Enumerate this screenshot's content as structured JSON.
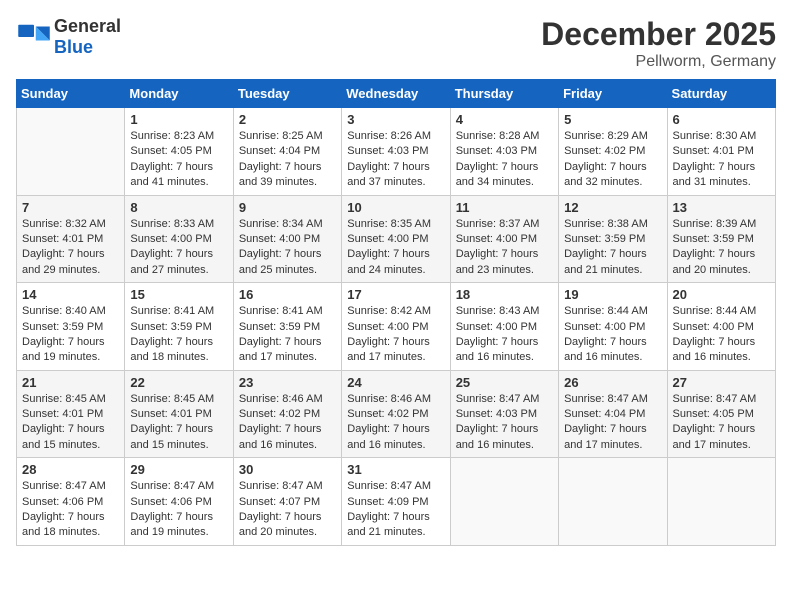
{
  "header": {
    "logo_general": "General",
    "logo_blue": "Blue",
    "title": "December 2025",
    "subtitle": "Pellworm, Germany"
  },
  "weekdays": [
    "Sunday",
    "Monday",
    "Tuesday",
    "Wednesday",
    "Thursday",
    "Friday",
    "Saturday"
  ],
  "weeks": [
    [
      {
        "day": "",
        "info": ""
      },
      {
        "day": "1",
        "info": "Sunrise: 8:23 AM\nSunset: 4:05 PM\nDaylight: 7 hours\nand 41 minutes."
      },
      {
        "day": "2",
        "info": "Sunrise: 8:25 AM\nSunset: 4:04 PM\nDaylight: 7 hours\nand 39 minutes."
      },
      {
        "day": "3",
        "info": "Sunrise: 8:26 AM\nSunset: 4:03 PM\nDaylight: 7 hours\nand 37 minutes."
      },
      {
        "day": "4",
        "info": "Sunrise: 8:28 AM\nSunset: 4:03 PM\nDaylight: 7 hours\nand 34 minutes."
      },
      {
        "day": "5",
        "info": "Sunrise: 8:29 AM\nSunset: 4:02 PM\nDaylight: 7 hours\nand 32 minutes."
      },
      {
        "day": "6",
        "info": "Sunrise: 8:30 AM\nSunset: 4:01 PM\nDaylight: 7 hours\nand 31 minutes."
      }
    ],
    [
      {
        "day": "7",
        "info": "Sunrise: 8:32 AM\nSunset: 4:01 PM\nDaylight: 7 hours\nand 29 minutes."
      },
      {
        "day": "8",
        "info": "Sunrise: 8:33 AM\nSunset: 4:00 PM\nDaylight: 7 hours\nand 27 minutes."
      },
      {
        "day": "9",
        "info": "Sunrise: 8:34 AM\nSunset: 4:00 PM\nDaylight: 7 hours\nand 25 minutes."
      },
      {
        "day": "10",
        "info": "Sunrise: 8:35 AM\nSunset: 4:00 PM\nDaylight: 7 hours\nand 24 minutes."
      },
      {
        "day": "11",
        "info": "Sunrise: 8:37 AM\nSunset: 4:00 PM\nDaylight: 7 hours\nand 23 minutes."
      },
      {
        "day": "12",
        "info": "Sunrise: 8:38 AM\nSunset: 3:59 PM\nDaylight: 7 hours\nand 21 minutes."
      },
      {
        "day": "13",
        "info": "Sunrise: 8:39 AM\nSunset: 3:59 PM\nDaylight: 7 hours\nand 20 minutes."
      }
    ],
    [
      {
        "day": "14",
        "info": "Sunrise: 8:40 AM\nSunset: 3:59 PM\nDaylight: 7 hours\nand 19 minutes."
      },
      {
        "day": "15",
        "info": "Sunrise: 8:41 AM\nSunset: 3:59 PM\nDaylight: 7 hours\nand 18 minutes."
      },
      {
        "day": "16",
        "info": "Sunrise: 8:41 AM\nSunset: 3:59 PM\nDaylight: 7 hours\nand 17 minutes."
      },
      {
        "day": "17",
        "info": "Sunrise: 8:42 AM\nSunset: 4:00 PM\nDaylight: 7 hours\nand 17 minutes."
      },
      {
        "day": "18",
        "info": "Sunrise: 8:43 AM\nSunset: 4:00 PM\nDaylight: 7 hours\nand 16 minutes."
      },
      {
        "day": "19",
        "info": "Sunrise: 8:44 AM\nSunset: 4:00 PM\nDaylight: 7 hours\nand 16 minutes."
      },
      {
        "day": "20",
        "info": "Sunrise: 8:44 AM\nSunset: 4:00 PM\nDaylight: 7 hours\nand 16 minutes."
      }
    ],
    [
      {
        "day": "21",
        "info": "Sunrise: 8:45 AM\nSunset: 4:01 PM\nDaylight: 7 hours\nand 15 minutes."
      },
      {
        "day": "22",
        "info": "Sunrise: 8:45 AM\nSunset: 4:01 PM\nDaylight: 7 hours\nand 15 minutes."
      },
      {
        "day": "23",
        "info": "Sunrise: 8:46 AM\nSunset: 4:02 PM\nDaylight: 7 hours\nand 16 minutes."
      },
      {
        "day": "24",
        "info": "Sunrise: 8:46 AM\nSunset: 4:02 PM\nDaylight: 7 hours\nand 16 minutes."
      },
      {
        "day": "25",
        "info": "Sunrise: 8:47 AM\nSunset: 4:03 PM\nDaylight: 7 hours\nand 16 minutes."
      },
      {
        "day": "26",
        "info": "Sunrise: 8:47 AM\nSunset: 4:04 PM\nDaylight: 7 hours\nand 17 minutes."
      },
      {
        "day": "27",
        "info": "Sunrise: 8:47 AM\nSunset: 4:05 PM\nDaylight: 7 hours\nand 17 minutes."
      }
    ],
    [
      {
        "day": "28",
        "info": "Sunrise: 8:47 AM\nSunset: 4:06 PM\nDaylight: 7 hours\nand 18 minutes."
      },
      {
        "day": "29",
        "info": "Sunrise: 8:47 AM\nSunset: 4:06 PM\nDaylight: 7 hours\nand 19 minutes."
      },
      {
        "day": "30",
        "info": "Sunrise: 8:47 AM\nSunset: 4:07 PM\nDaylight: 7 hours\nand 20 minutes."
      },
      {
        "day": "31",
        "info": "Sunrise: 8:47 AM\nSunset: 4:09 PM\nDaylight: 7 hours\nand 21 minutes."
      },
      {
        "day": "",
        "info": ""
      },
      {
        "day": "",
        "info": ""
      },
      {
        "day": "",
        "info": ""
      }
    ]
  ]
}
